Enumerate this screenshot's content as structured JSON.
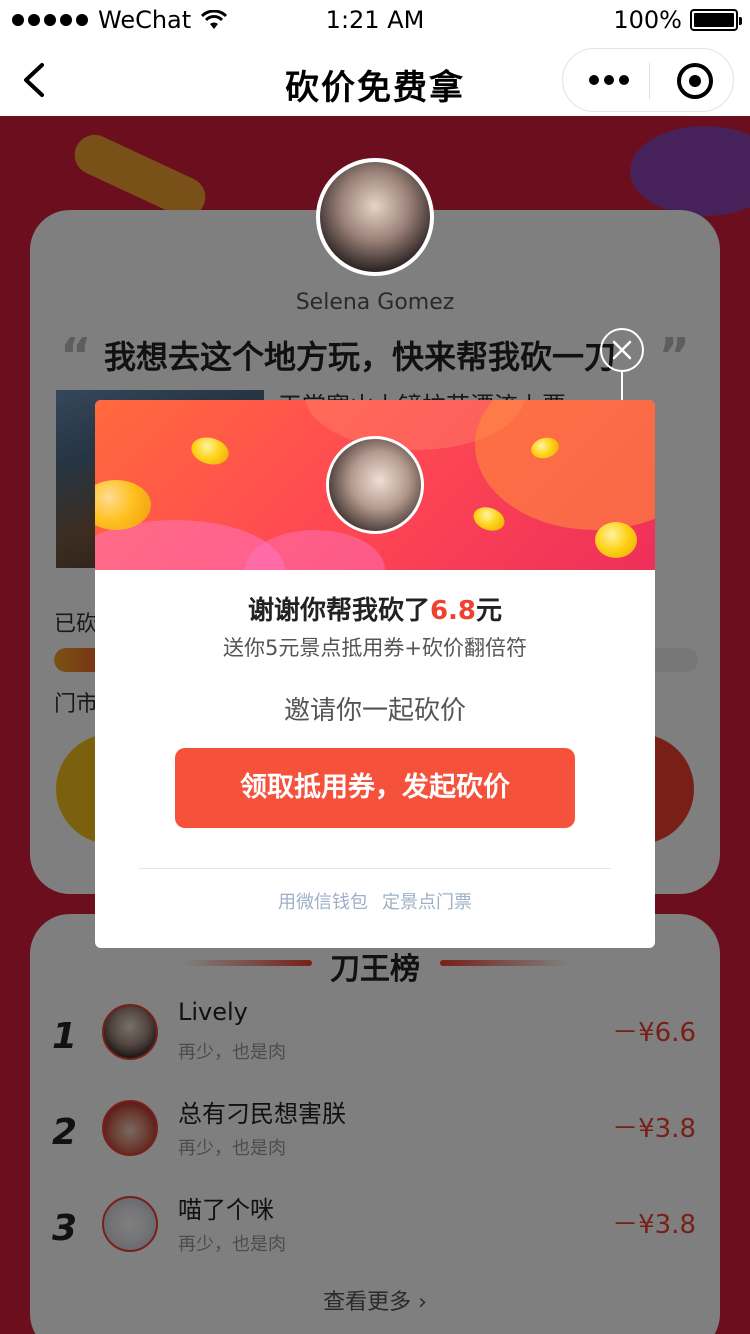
{
  "status_bar": {
    "carrier": "WeChat",
    "time": "1:21 AM",
    "battery": "100%"
  },
  "navbar": {
    "title": "砍价免费拿"
  },
  "background": {
    "username": "Selena Gomez",
    "quote": "我想去这个地方玩，快来帮我砍一刀",
    "spot_title": "天堂寨山上镜拉花漂流上票",
    "cut_label": "已砍",
    "progress_fraction": 0.1,
    "price_label": "门市",
    "ranking": {
      "title": "刀王榜",
      "items": [
        {
          "rank": "1",
          "name": "Lively",
          "sub": "再少，也是肉",
          "amount": "－¥6.6"
        },
        {
          "rank": "2",
          "name": "总有刁民想害朕",
          "sub": "再少，也是肉",
          "amount": "－¥3.8"
        },
        {
          "rank": "3",
          "name": "喵了个咪",
          "sub": "再少，也是肉",
          "amount": "－¥3.8"
        }
      ],
      "view_more": "查看更多 ›"
    }
  },
  "modal": {
    "title_prefix": "谢谢你帮我砍了",
    "amount": "6.8",
    "title_suffix": "元",
    "subtitle": "送你5元景点抵用券+砍价翻倍符",
    "invite": "邀请你一起砍价",
    "button": "领取抵用券，发起砍价",
    "footer_left": "用微信钱包",
    "footer_right": "定景点门票"
  },
  "colors": {
    "accent": "#f04130",
    "page_bg": "#d61e3e",
    "button": "#f5513b",
    "footer_link": "#9db0c8"
  }
}
